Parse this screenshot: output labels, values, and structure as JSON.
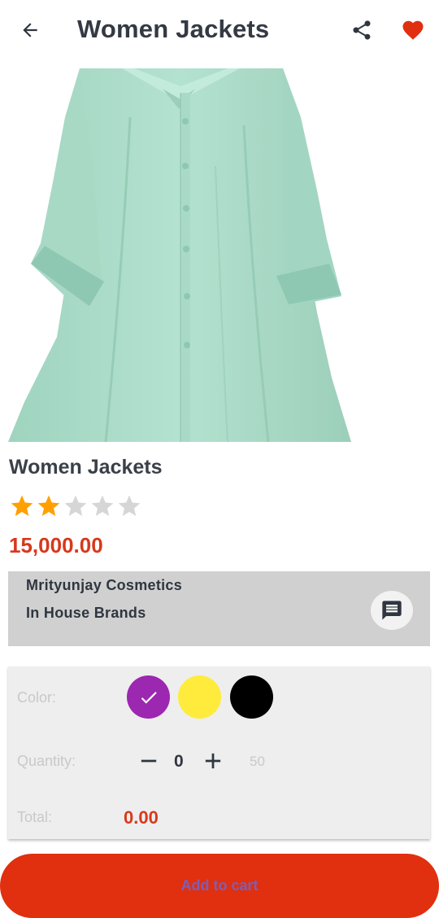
{
  "header": {
    "title": "Women Jackets",
    "back_icon": "arrow-left-icon",
    "share_icon": "share-icon",
    "favorite_icon": "heart-icon"
  },
  "product": {
    "name": "Women Jackets",
    "rating": 2,
    "rating_max": 5,
    "price": "15,000.00",
    "image": "mint-green-shirt-jacket"
  },
  "seller": {
    "name": "Mrityunjay Cosmetics",
    "brand": "In House Brands",
    "chat_icon": "chat-icon"
  },
  "options": {
    "color_label": "Color:",
    "colors": [
      {
        "hex": "#9c27b0",
        "selected": true
      },
      {
        "hex": "#ffeb3b",
        "selected": false
      },
      {
        "hex": "#000000",
        "selected": false
      }
    ],
    "quantity_label": "Quantity:",
    "quantity": "0",
    "stock": "50",
    "total_label": "Total:",
    "total": "0.00"
  },
  "cart_button": {
    "label": "Add to cart"
  },
  "colors": {
    "accent": "#e0300f",
    "price": "#d7381c",
    "star_on": "#ffa000",
    "star_off": "#d6d6d6",
    "favorite": "#e0300f"
  }
}
